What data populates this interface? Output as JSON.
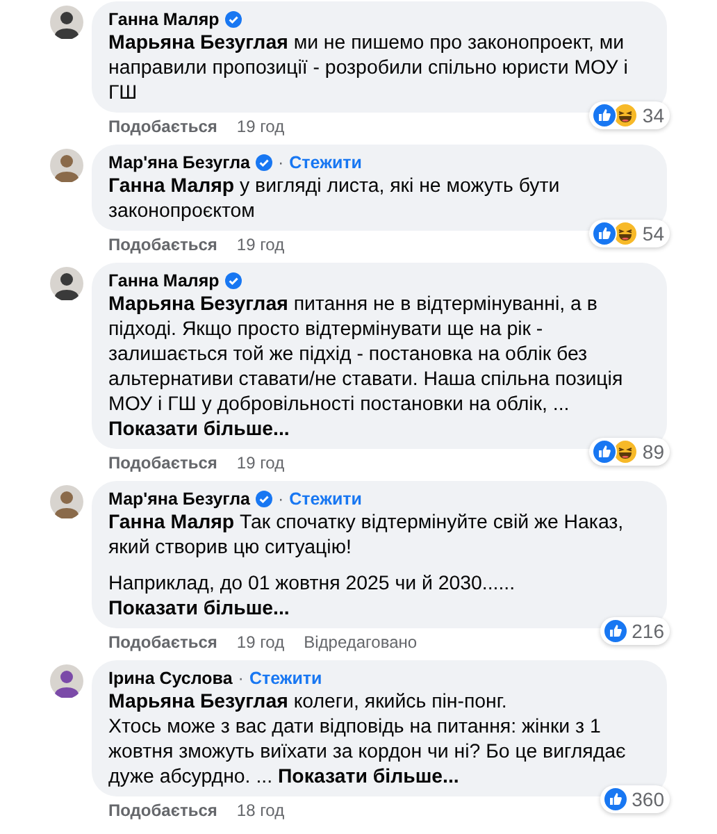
{
  "comments": [
    {
      "author": "Ганна Маляр",
      "verified": true,
      "paragraphs": [
        {
          "text": "**Марьяна Безуглая** ми не пишемо про законопроект, ми направили пропозиції - розробили спільно юристи МОУ і ГШ"
        }
      ],
      "reactions": [
        {
          "kind": "like"
        },
        {
          "kind": "haha"
        }
      ],
      "reaction_count": "34",
      "actions": {
        "like": "Подобається",
        "time": "19 год"
      }
    },
    {
      "author": "Мар'яна Безугла",
      "verified": true,
      "follow": {
        "separator": "·",
        "label": "Стежити"
      },
      "paragraphs": [
        {
          "text": "**Ганна Маляр** у вигляді листа, які не можуть бути законопроєктом"
        }
      ],
      "reactions": [
        {
          "kind": "like"
        },
        {
          "kind": "haha"
        }
      ],
      "reaction_count": "54",
      "actions": {
        "like": "Подобається",
        "time": "19 год"
      }
    },
    {
      "author": "Ганна Маляр",
      "verified": true,
      "paragraphs": [
        {
          "text": "**Марьяна Безуглая** питання не в відтермінуванні, а в підході. Якщо просто відтермінувати ще на рік - залишається той же підхід - постановка на облік без альтернативи ставати/не ставати. Наша спільна позиція МОУ і ГШ у добровільності постановки на облік, ...",
          "more": "Показати більше..."
        }
      ],
      "reactions": [
        {
          "kind": "like"
        },
        {
          "kind": "haha"
        }
      ],
      "reaction_count": "89",
      "actions": {
        "like": "Подобається",
        "time": "19 год"
      }
    },
    {
      "author": "Мар'яна Безугла",
      "verified": true,
      "follow": {
        "separator": "·",
        "label": "Стежити"
      },
      "paragraphs": [
        {
          "text": "**Ганна Маляр** Так спочатку відтермінуйте свій же Наказ, який створив цю ситуацію!"
        },
        {
          "text": "Наприклад, до 01 жовтня 2025 чи й 2030......",
          "more": "Показати більше..."
        }
      ],
      "reactions": [
        {
          "kind": "like"
        }
      ],
      "reaction_count": "216",
      "actions": {
        "like": "Подобається",
        "time": "19 год",
        "edited": "Відредаговано"
      }
    },
    {
      "author": "Ірина Суслова",
      "follow": {
        "separator": "·",
        "label": "Стежити"
      },
      "paragraphs": [
        {
          "text": "**Марьяна Безуглая** колеги, якийсь пін-понг.\nХтось може з вас дати відповідь на питання: жінки з 1 жовтня зможуть виїхати за кордон чи ні? Бо це виглядає дуже абсурдно. ...",
          "more": "Показати більше..."
        }
      ],
      "reactions": [
        {
          "kind": "like"
        }
      ],
      "reaction_count": "360",
      "actions": {
        "like": "Подобається",
        "time": "18 год"
      }
    }
  ]
}
